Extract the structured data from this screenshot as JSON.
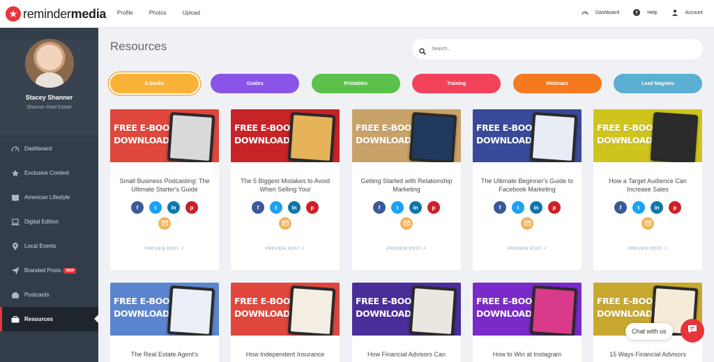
{
  "brand": {
    "name_light": "reminder",
    "name_bold": "media",
    "accent": "#e8343b"
  },
  "topnav": [
    {
      "label": "Profile"
    },
    {
      "label": "Photos"
    },
    {
      "label": "Upload"
    }
  ],
  "topright": [
    {
      "label": "Dashboard",
      "icon": "gauge-icon"
    },
    {
      "label": "Help",
      "icon": "help-icon"
    },
    {
      "label": "Account",
      "icon": "user-icon"
    }
  ],
  "profile": {
    "name": "Stacey Shanner",
    "company": "Shanner Real Estate"
  },
  "sidebar": {
    "items": [
      {
        "label": "Dashboard",
        "icon": "gauge-icon"
      },
      {
        "label": "Exclusive Content",
        "icon": "star-icon"
      },
      {
        "label": "American Lifestyle",
        "icon": "book-icon"
      },
      {
        "label": "Digital Edition",
        "icon": "laptop-icon"
      },
      {
        "label": "Local Events",
        "icon": "location-icon"
      },
      {
        "label": "Branded Posts",
        "icon": "send-icon",
        "badge": "NEW"
      },
      {
        "label": "Postcards",
        "icon": "mailbox-icon"
      },
      {
        "label": "Resources",
        "icon": "briefcase-icon",
        "active": true
      }
    ]
  },
  "main": {
    "title": "Resources",
    "search_placeholder": "Search...",
    "categories": [
      {
        "label": "E-books",
        "color": "#f9b138",
        "selected": true
      },
      {
        "label": "Guides",
        "color": "#8b54e8"
      },
      {
        "label": "Printables",
        "color": "#5bc14b"
      },
      {
        "label": "Training",
        "color": "#f2425a"
      },
      {
        "label": "Webinars",
        "color": "#f57a1f"
      },
      {
        "label": "Lead Magnets",
        "color": "#5aafd2"
      }
    ],
    "thumb_label_1": "FREE E-BOOK",
    "thumb_label_2": "DOWNLOAD",
    "preview_label": "PREVIEW POST",
    "cards": [
      {
        "title": "Small Business Podcasting: The Ultimate Starter's Guide",
        "bg": "#e0473d",
        "screen": "#d9d9d9"
      },
      {
        "title": "The 5 Biggest Mistakes to Avoid When Selling Your",
        "bg": "#c82327",
        "screen": "#e6b25a"
      },
      {
        "title": "Getting Started with Relationship Marketing",
        "bg": "#c9a26a",
        "screen": "#1f3a5c"
      },
      {
        "title": "The Ultimate Beginner's Guide to Facebook Marketing",
        "bg": "#3a4a9a",
        "screen": "#e8ecf4"
      },
      {
        "title": "How a Target Audience Can Increase Sales",
        "bg": "#cfc41e",
        "screen": "#2b2b2b"
      },
      {
        "title": "The Real Estate Agent's",
        "bg": "#5b86cf",
        "screen": "#e9eef7"
      },
      {
        "title": "How Independent Insurance",
        "bg": "#e0473d",
        "screen": "#f3ede4"
      },
      {
        "title": "How Financial Advisors Can",
        "bg": "#4a2e9a",
        "screen": "#eae7e0"
      },
      {
        "title": "How to Win at Instagram",
        "bg": "#7a2ac9",
        "screen": "#d93a8a"
      },
      {
        "title": "15 Ways Financial Advisors",
        "bg": "#c9a830",
        "screen": "#f4ecd8"
      }
    ],
    "socials": [
      {
        "name": "facebook",
        "glyph": "f",
        "color": "#3b5998"
      },
      {
        "name": "twitter",
        "glyph": "t",
        "color": "#1da1f2"
      },
      {
        "name": "linkedin",
        "glyph": "in",
        "color": "#0e76a8"
      },
      {
        "name": "pinterest",
        "glyph": "p",
        "color": "#cb2027"
      }
    ],
    "mail_color": "#f3b45e"
  },
  "chat": {
    "label": "Chat with us"
  }
}
